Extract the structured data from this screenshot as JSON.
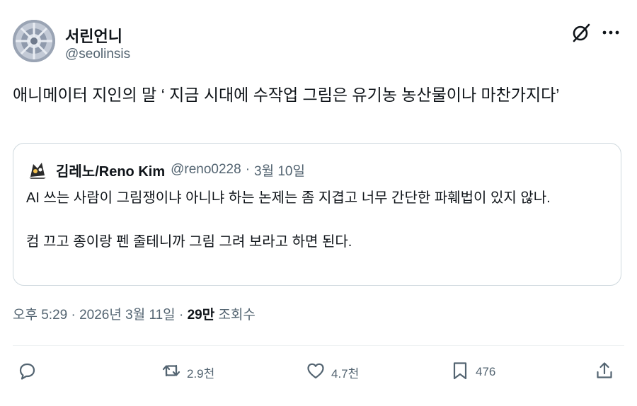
{
  "author": {
    "display_name": "서린언니",
    "handle": "@seolinsis"
  },
  "header_icons": {
    "grok": "grok-slash-icon",
    "more": "more-dots-icon"
  },
  "tweet": {
    "text": "애니메이터 지인의 말 ‘ 지금 시대에 수작업 그림은 유기농 농산물이나 마찬가지다’"
  },
  "quote": {
    "display_name": "김레노/Reno Kim",
    "handle": "@reno0228",
    "separator": "·",
    "date": "3월 10일",
    "text": "AI 쓰는 사람이 그림쟁이냐 아니냐 하는 논제는 좀 지겹고 너무 간단한 파훼법이 있지 않나.\n\n컴 끄고 종이랑 펜 줄테니까 그림 그려 보라고 하면 된다."
  },
  "meta": {
    "time": "오후 5:29",
    "separator": "·",
    "date": "2026년 3월 11일",
    "separator2": "·",
    "views_count": "29만",
    "views_label": "조회수"
  },
  "actions": {
    "reply": {
      "icon": "reply-icon"
    },
    "retweet": {
      "icon": "retweet-icon",
      "count": "2.9천"
    },
    "like": {
      "icon": "heart-icon",
      "count": "4.7천"
    },
    "bookmark": {
      "icon": "bookmark-icon",
      "count": "476"
    },
    "share": {
      "icon": "share-icon"
    }
  },
  "colors": {
    "text": "#0f1419",
    "secondary": "#536471",
    "border": "#cfd9de"
  }
}
